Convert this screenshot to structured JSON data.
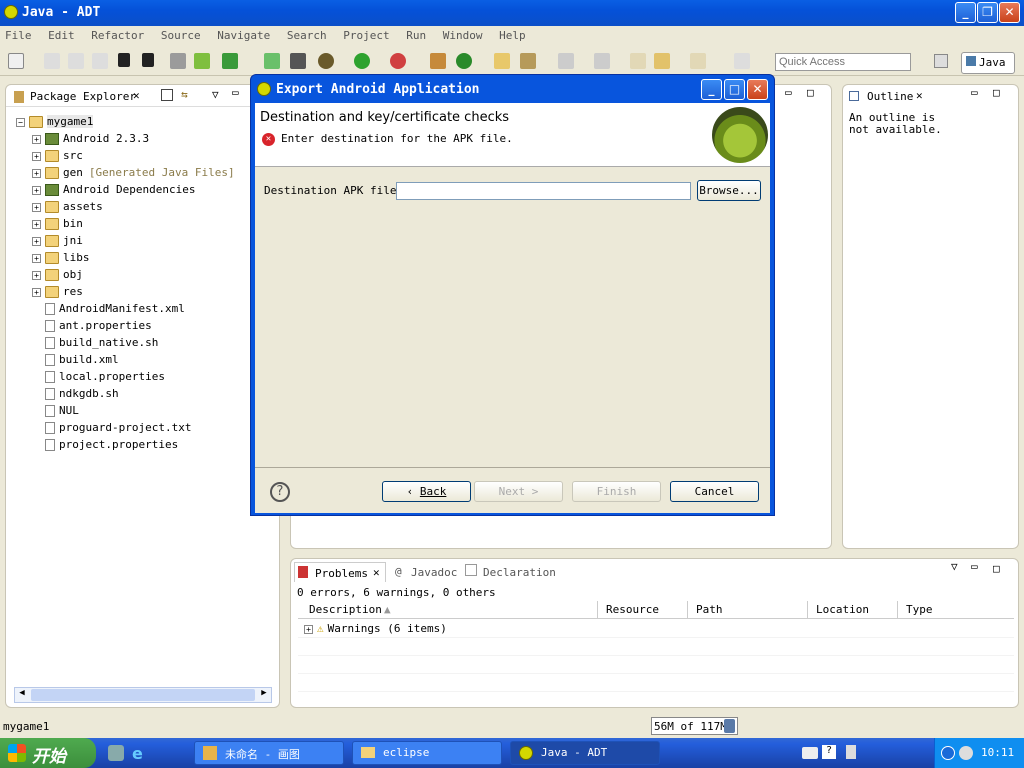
{
  "window": {
    "title": "Java - ADT"
  },
  "menu": [
    "File",
    "Edit",
    "Refactor",
    "Source",
    "Navigate",
    "Search",
    "Project",
    "Run",
    "Window",
    "Help"
  ],
  "toolbar": {
    "quick_access_placeholder": "Quick Access",
    "perspective": "Java"
  },
  "package_explorer": {
    "tab": "Package Explorer",
    "project": "mygame1",
    "items": [
      {
        "label": "Android 2.3.3",
        "kind": "lib",
        "expand": true
      },
      {
        "label": "src",
        "kind": "folder",
        "expand": true
      },
      {
        "label": "gen",
        "suffix": "[Generated Java Files]",
        "kind": "folder",
        "expand": true
      },
      {
        "label": "Android Dependencies",
        "kind": "lib",
        "expand": true
      },
      {
        "label": "assets",
        "kind": "folder",
        "expand": true
      },
      {
        "label": "bin",
        "kind": "folder",
        "expand": true
      },
      {
        "label": "jni",
        "kind": "folder",
        "expand": true
      },
      {
        "label": "libs",
        "kind": "folder",
        "expand": true
      },
      {
        "label": "obj",
        "kind": "folder",
        "expand": true
      },
      {
        "label": "res",
        "kind": "folder",
        "expand": true
      },
      {
        "label": "AndroidManifest.xml",
        "kind": "file"
      },
      {
        "label": "ant.properties",
        "kind": "file"
      },
      {
        "label": "build_native.sh",
        "kind": "file"
      },
      {
        "label": "build.xml",
        "kind": "file"
      },
      {
        "label": "local.properties",
        "kind": "file"
      },
      {
        "label": "ndkgdb.sh",
        "kind": "file"
      },
      {
        "label": "NUL",
        "kind": "file"
      },
      {
        "label": "proguard-project.txt",
        "kind": "file"
      },
      {
        "label": "project.properties",
        "kind": "file"
      }
    ]
  },
  "outline": {
    "tab": "Outline",
    "message": "An outline is not available."
  },
  "problems": {
    "tabs": [
      "Problems",
      "Javadoc",
      "Declaration"
    ],
    "summary": "0 errors, 6 warnings, 0 others",
    "columns": [
      "Description",
      "Resource",
      "Path",
      "Location",
      "Type"
    ],
    "rows": [
      "Warnings (6 items)"
    ]
  },
  "dialog": {
    "title": "Export Android Application",
    "heading": "Destination and key/certificate checks",
    "error_message": "Enter destination for the APK file.",
    "field_label": "Destination APK file:",
    "field_value": "",
    "browse": "Browse...",
    "back": "Back",
    "next": "Next >",
    "finish": "Finish",
    "cancel": "Cancel"
  },
  "status": {
    "selection": "mygame1",
    "memory": "56M of 117M"
  },
  "taskbar": {
    "start": "开始",
    "tasks": [
      "未命名 - 画图",
      "eclipse",
      "Java - ADT"
    ],
    "clock": "10:11"
  },
  "colors": {
    "title_blue": "#0a5fe4",
    "taskbar_blue": "#245edb",
    "start_green": "#3c8f3c",
    "error_red": "#d8242b"
  }
}
